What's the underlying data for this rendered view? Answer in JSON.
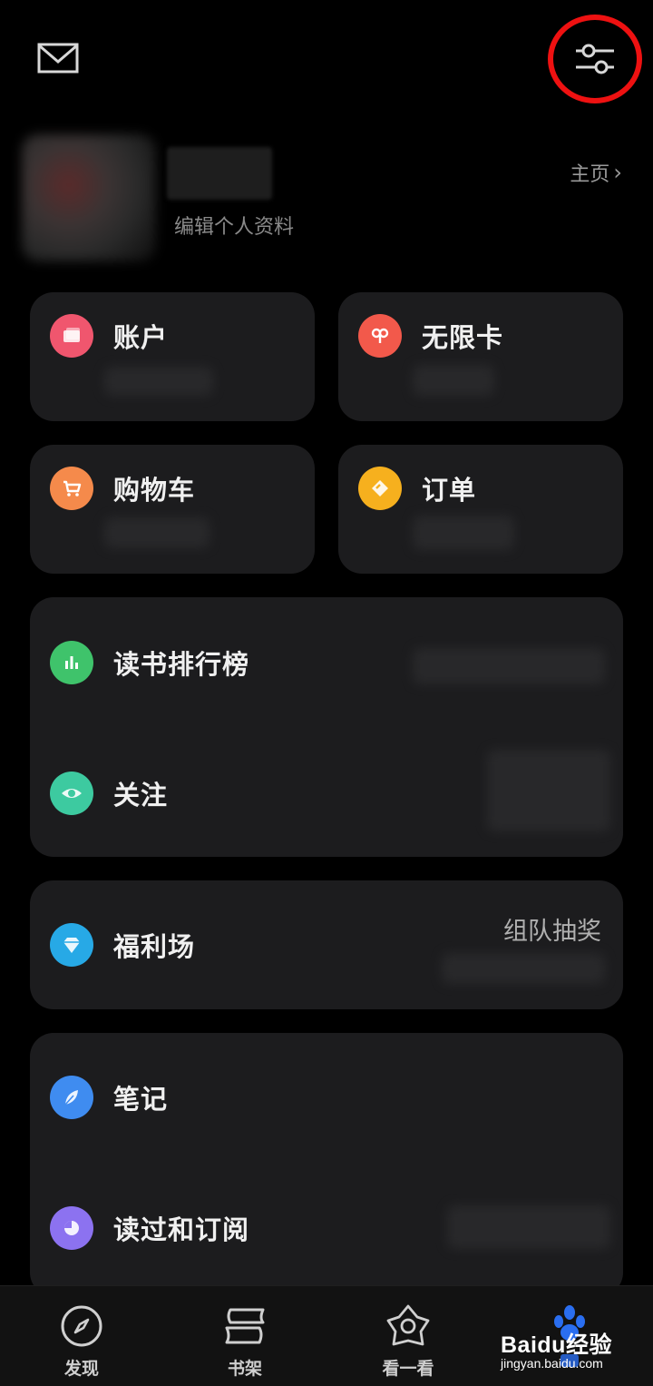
{
  "profile": {
    "edit_label": "编辑个人资料",
    "home_label": "主页",
    "home_chevron": "›"
  },
  "cards": {
    "account": "账户",
    "unlimited_card": "无限卡",
    "cart": "购物车",
    "orders": "订单",
    "ranking": "读书排行榜",
    "following": "关注",
    "welfare": "福利场",
    "welfare_side": "组队抽奖",
    "notes": "笔记",
    "read_subscribed": "读过和订阅"
  },
  "nav": {
    "discover": "发现",
    "bookshelf": "书架",
    "look": "看一看"
  },
  "watermark": {
    "text": "Baidu经验",
    "url": "jingyan.baidu.com"
  },
  "colors": {
    "highlight_ring": "#e11111",
    "account_icon": "#f0566e",
    "unlimited_icon": "#f2594b",
    "cart_icon": "#f58a4b",
    "orders_icon": "#f6b01e",
    "ranking_icon": "#3fc36b",
    "following_icon": "#3dcaa0",
    "welfare_icon": "#27a9e6",
    "notes_icon": "#3f8cf0",
    "read_icon": "#8c72f0"
  }
}
